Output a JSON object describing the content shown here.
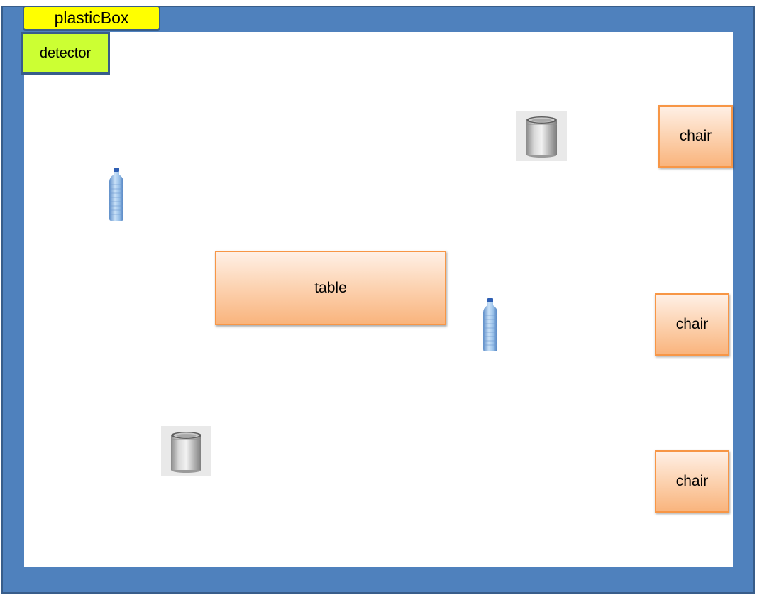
{
  "container": {
    "label": "plasticBox",
    "label_color": "#ffff00",
    "frame_color": "#4f81bd"
  },
  "detector": {
    "label": "detector",
    "color": "#ccff33"
  },
  "furniture": {
    "table_label": "table",
    "chair_labels": [
      "chair",
      "chair",
      "chair"
    ],
    "fill_color": "#fcd2b0",
    "border_color": "#f79646"
  },
  "objects": {
    "cans": [
      {
        "icon": "tin-can-icon"
      },
      {
        "icon": "tin-can-icon"
      }
    ],
    "bottles": [
      {
        "icon": "water-bottle-icon"
      },
      {
        "icon": "water-bottle-icon"
      }
    ]
  }
}
